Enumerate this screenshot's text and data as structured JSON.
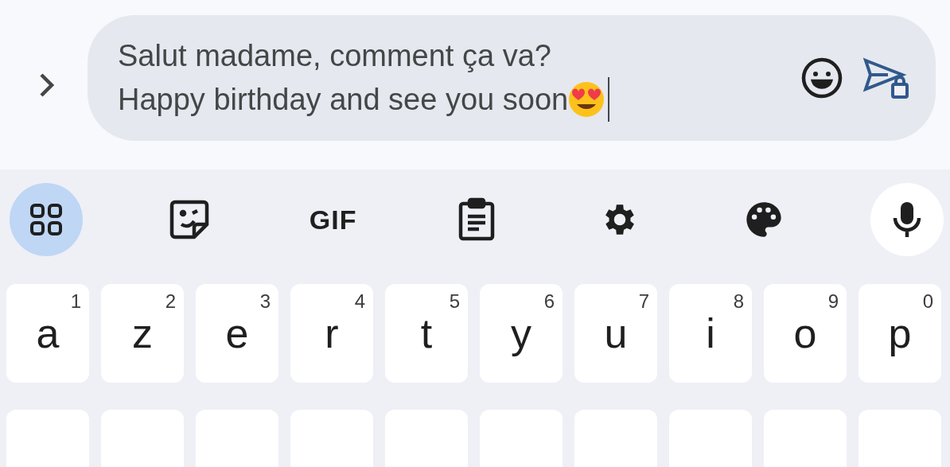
{
  "compose": {
    "text_lines": [
      "Salut madame, comment ça va?",
      "Happy birthday and see you soon"
    ]
  },
  "toolbar": [
    {
      "kind": "grid",
      "selected": true
    },
    {
      "kind": "sticker",
      "selected": false
    },
    {
      "kind": "gif",
      "label": "GIF",
      "selected": false
    },
    {
      "kind": "clipboard",
      "selected": false
    },
    {
      "kind": "settings",
      "selected": false
    },
    {
      "kind": "palette",
      "selected": false
    },
    {
      "kind": "mic",
      "selected": false
    }
  ],
  "key_rows": [
    [
      {
        "letter": "a",
        "hint": "1"
      },
      {
        "letter": "z",
        "hint": "2"
      },
      {
        "letter": "e",
        "hint": "3"
      },
      {
        "letter": "r",
        "hint": "4"
      },
      {
        "letter": "t",
        "hint": "5"
      },
      {
        "letter": "y",
        "hint": "6"
      },
      {
        "letter": "u",
        "hint": "7"
      },
      {
        "letter": "i",
        "hint": "8"
      },
      {
        "letter": "o",
        "hint": "9"
      },
      {
        "letter": "p",
        "hint": "0"
      }
    ],
    [
      {
        "kind": "cut"
      },
      {
        "kind": "cut"
      },
      {
        "kind": "cut"
      },
      {
        "kind": "cut"
      },
      {
        "kind": "cut"
      },
      {
        "kind": "cut"
      },
      {
        "kind": "cut"
      },
      {
        "kind": "cut"
      },
      {
        "kind": "cut"
      },
      {
        "kind": "cut"
      }
    ]
  ]
}
